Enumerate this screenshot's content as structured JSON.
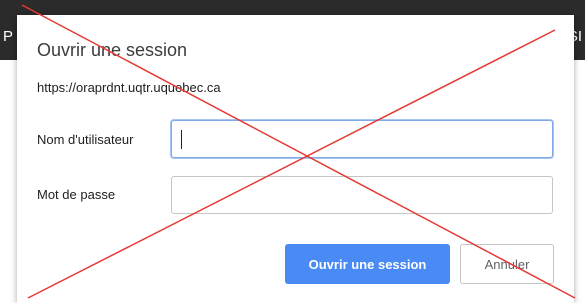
{
  "background": {
    "left_fragment": "P",
    "right_fragment": "SI"
  },
  "dialog": {
    "title": "Ouvrir une session",
    "url": "https://oraprdnt.uqtr.uquebec.ca",
    "username_label": "Nom d'utilisateur",
    "username_value": "",
    "password_label": "Mot de passe",
    "password_value": "",
    "submit_label": "Ouvrir une session",
    "cancel_label": "Annuler"
  },
  "colors": {
    "primary_button": "#4a8af4",
    "cross_lines": "#e53935",
    "focus_border": "#7fa9e8"
  }
}
